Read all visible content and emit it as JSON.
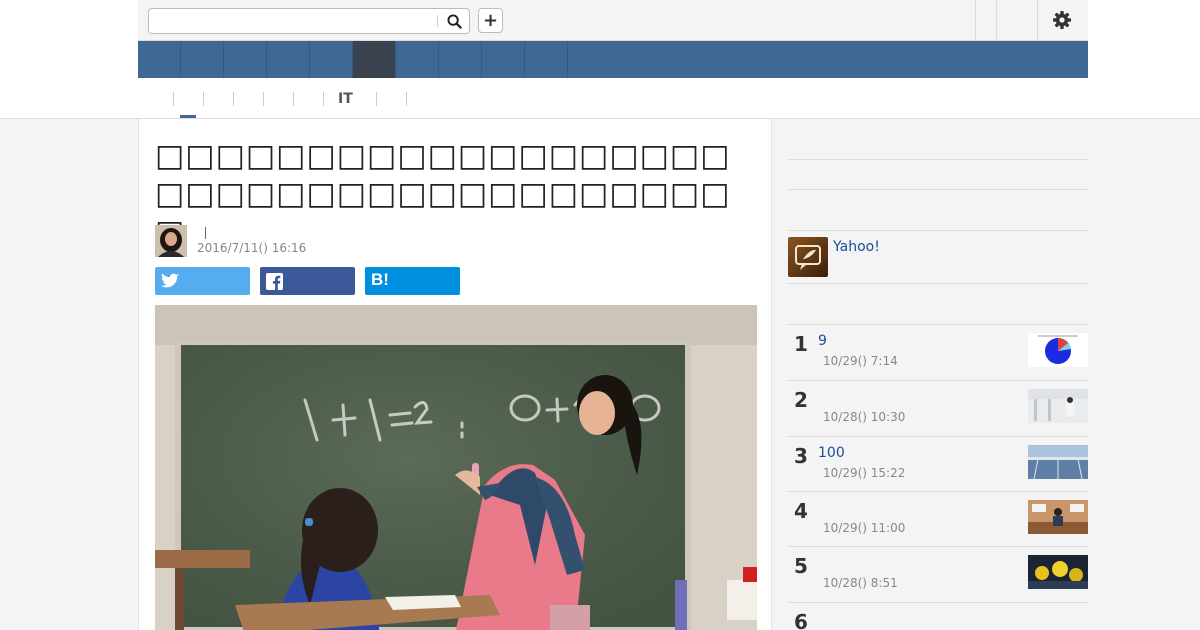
{
  "search": {
    "placeholder": ""
  },
  "toolbar": {
    "plus_label": "+"
  },
  "subnav": {
    "items": [
      "",
      "",
      "",
      "",
      "",
      "IT",
      ""
    ]
  },
  "article": {
    "title": "□□□□□□□□□□□□□□□□□□□□□□□□□□□□□□□□□□□□□□□",
    "author": "",
    "date": "2016/7/11() 16:16",
    "share": {
      "twitter": "",
      "facebook": "",
      "hatena": "B!"
    }
  },
  "sidebar": {
    "yahoo_link": "Yahoo!",
    "ranking": [
      {
        "rank": "1",
        "title": "9",
        "time": "10/29() 7:14"
      },
      {
        "rank": "2",
        "title": "",
        "time": "10/28() 10:30"
      },
      {
        "rank": "3",
        "title": "100",
        "time": "10/29() 15:22"
      },
      {
        "rank": "4",
        "title": "",
        "time": "10/29() 11:00"
      },
      {
        "rank": "5",
        "title": "",
        "time": "10/28() 8:51"
      },
      {
        "rank": "6",
        "title": "",
        "time": ""
      }
    ]
  },
  "colors": {
    "nav": "#3f6894",
    "nav_active": "#3b4250",
    "twitter": "#55acee",
    "facebook": "#3b5998",
    "hatena": "#008fde",
    "link": "#1a4d99"
  },
  "icons": [
    "search-icon",
    "plus-icon",
    "gear-icon",
    "twitter-icon",
    "facebook-icon",
    "hatena-icon",
    "yahoo-news-icon"
  ]
}
